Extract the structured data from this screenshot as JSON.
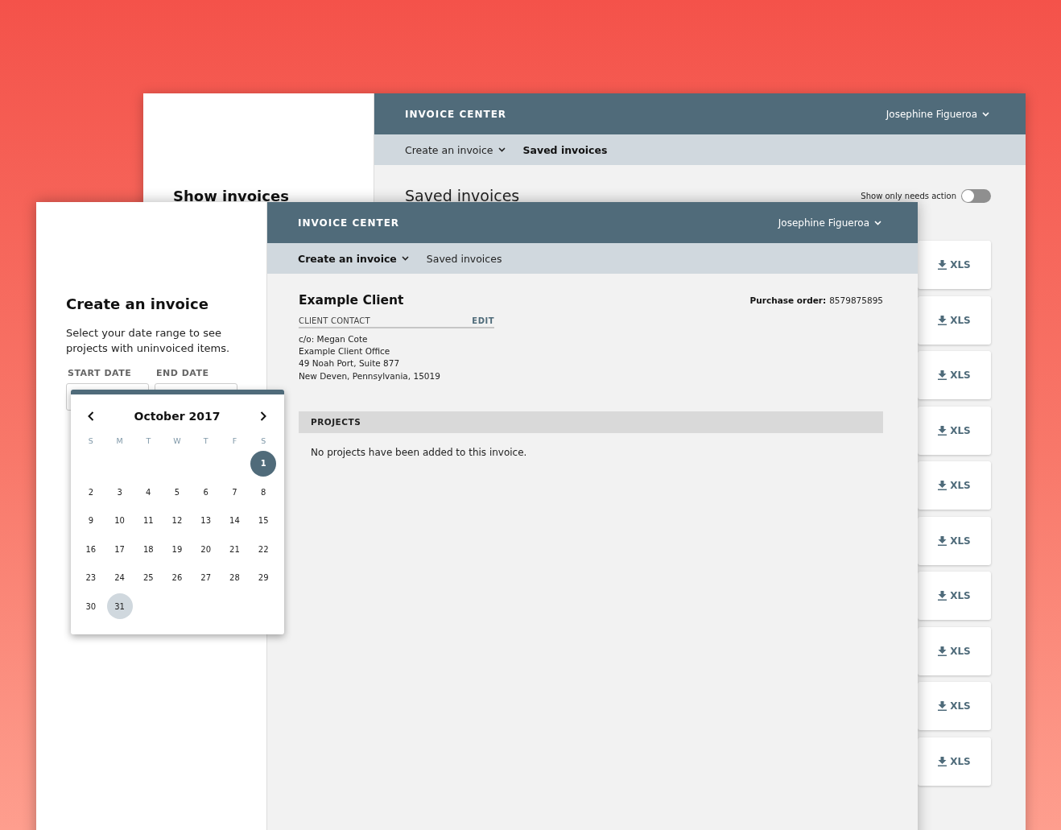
{
  "background_window": {
    "header": {
      "app_title": "INVOICE CENTER",
      "user": "Josephine Figueroa"
    },
    "nav": [
      {
        "label": "Create an invoice",
        "dropdown": true,
        "selected": false
      },
      {
        "label": "Saved invoices",
        "dropdown": false,
        "selected": true
      }
    ],
    "sidebar": {
      "heading": "Show invoices"
    },
    "page_title": "Saved invoices",
    "toggle": {
      "label": "Show only needs action",
      "on": false
    },
    "download_buttons": [
      {
        "label": "XLS"
      },
      {
        "label": "XLS"
      },
      {
        "label": "XLS"
      },
      {
        "label": "XLS"
      },
      {
        "label": "XLS"
      },
      {
        "label": "XLS"
      },
      {
        "label": "XLS"
      },
      {
        "label": "XLS"
      },
      {
        "label": "XLS"
      },
      {
        "label": "XLS"
      }
    ]
  },
  "foreground_window": {
    "header": {
      "app_title": "INVOICE CENTER",
      "user": "Josephine Figueroa"
    },
    "nav": [
      {
        "label": "Create an invoice",
        "dropdown": true,
        "selected": true
      },
      {
        "label": "Saved invoices",
        "dropdown": false,
        "selected": false
      }
    ],
    "sidebar": {
      "heading": "Create an invoice",
      "description": "Select your date range to see projects with uninvoiced items.",
      "date_fields": [
        {
          "label": "START DATE"
        },
        {
          "label": "END DATE"
        }
      ]
    },
    "client": {
      "name": "Example Client",
      "purchase_order_label": "Purchase order:",
      "purchase_order": "8579875895",
      "contact_heading": "CLIENT CONTACT",
      "edit": "EDIT",
      "address_lines": [
        "c/o: Megan Cote",
        "Example Client Office",
        "49 Noah Port, Suite 877",
        "New Deven, Pennsylvania, 15019"
      ]
    },
    "projects": {
      "heading": "PROJECTS",
      "empty_message": "No projects have been added to this invoice."
    }
  },
  "date_picker": {
    "month": "October 2017",
    "weekdays": [
      "S",
      "M",
      "T",
      "W",
      "T",
      "F",
      "S"
    ],
    "weeks": [
      {
        "days": [
          {
            "kind": "empty"
          },
          {
            "kind": "empty"
          },
          {
            "kind": "empty"
          },
          {
            "kind": "empty"
          },
          {
            "kind": "empty"
          },
          {
            "kind": "empty"
          },
          {
            "kind": "day",
            "label": "1",
            "selected": true,
            "highlighted": false
          }
        ]
      },
      {
        "days": [
          {
            "label": "2",
            "selected": false,
            "highlighted": false
          },
          {
            "label": "3",
            "selected": false,
            "highlighted": false
          },
          {
            "label": "4",
            "selected": false,
            "highlighted": false
          },
          {
            "label": "5",
            "selected": false,
            "highlighted": false
          },
          {
            "label": "6",
            "selected": false,
            "highlighted": false
          },
          {
            "label": "7",
            "selected": false,
            "highlighted": false
          },
          {
            "label": "8",
            "selected": false,
            "highlighted": false
          }
        ]
      },
      {
        "days": [
          {
            "label": "9",
            "selected": false,
            "highlighted": false
          },
          {
            "label": "10",
            "selected": false,
            "highlighted": false
          },
          {
            "label": "11",
            "selected": false,
            "highlighted": false
          },
          {
            "label": "12",
            "selected": false,
            "highlighted": false
          },
          {
            "label": "13",
            "selected": false,
            "highlighted": false
          },
          {
            "label": "14",
            "selected": false,
            "highlighted": false
          },
          {
            "label": "15",
            "selected": false,
            "highlighted": false
          }
        ]
      },
      {
        "days": [
          {
            "label": "16",
            "selected": false,
            "highlighted": false
          },
          {
            "label": "17",
            "selected": false,
            "highlighted": false
          },
          {
            "label": "18",
            "selected": false,
            "highlighted": false
          },
          {
            "label": "19",
            "selected": false,
            "highlighted": false
          },
          {
            "label": "20",
            "selected": false,
            "highlighted": false
          },
          {
            "label": "21",
            "selected": false,
            "highlighted": false
          },
          {
            "label": "22",
            "selected": false,
            "highlighted": false
          }
        ]
      },
      {
        "days": [
          {
            "label": "23",
            "selected": false,
            "highlighted": false
          },
          {
            "label": "24",
            "selected": false,
            "highlighted": false
          },
          {
            "label": "25",
            "selected": false,
            "highlighted": false
          },
          {
            "label": "26",
            "selected": false,
            "highlighted": false
          },
          {
            "label": "27",
            "selected": false,
            "highlighted": false
          },
          {
            "label": "28",
            "selected": false,
            "highlighted": false
          },
          {
            "label": "29",
            "selected": false,
            "highlighted": false
          }
        ]
      },
      {
        "days": [
          {
            "label": "30",
            "selected": false,
            "highlighted": false
          },
          {
            "label": "31",
            "selected": false,
            "highlighted": true
          }
        ]
      }
    ]
  }
}
